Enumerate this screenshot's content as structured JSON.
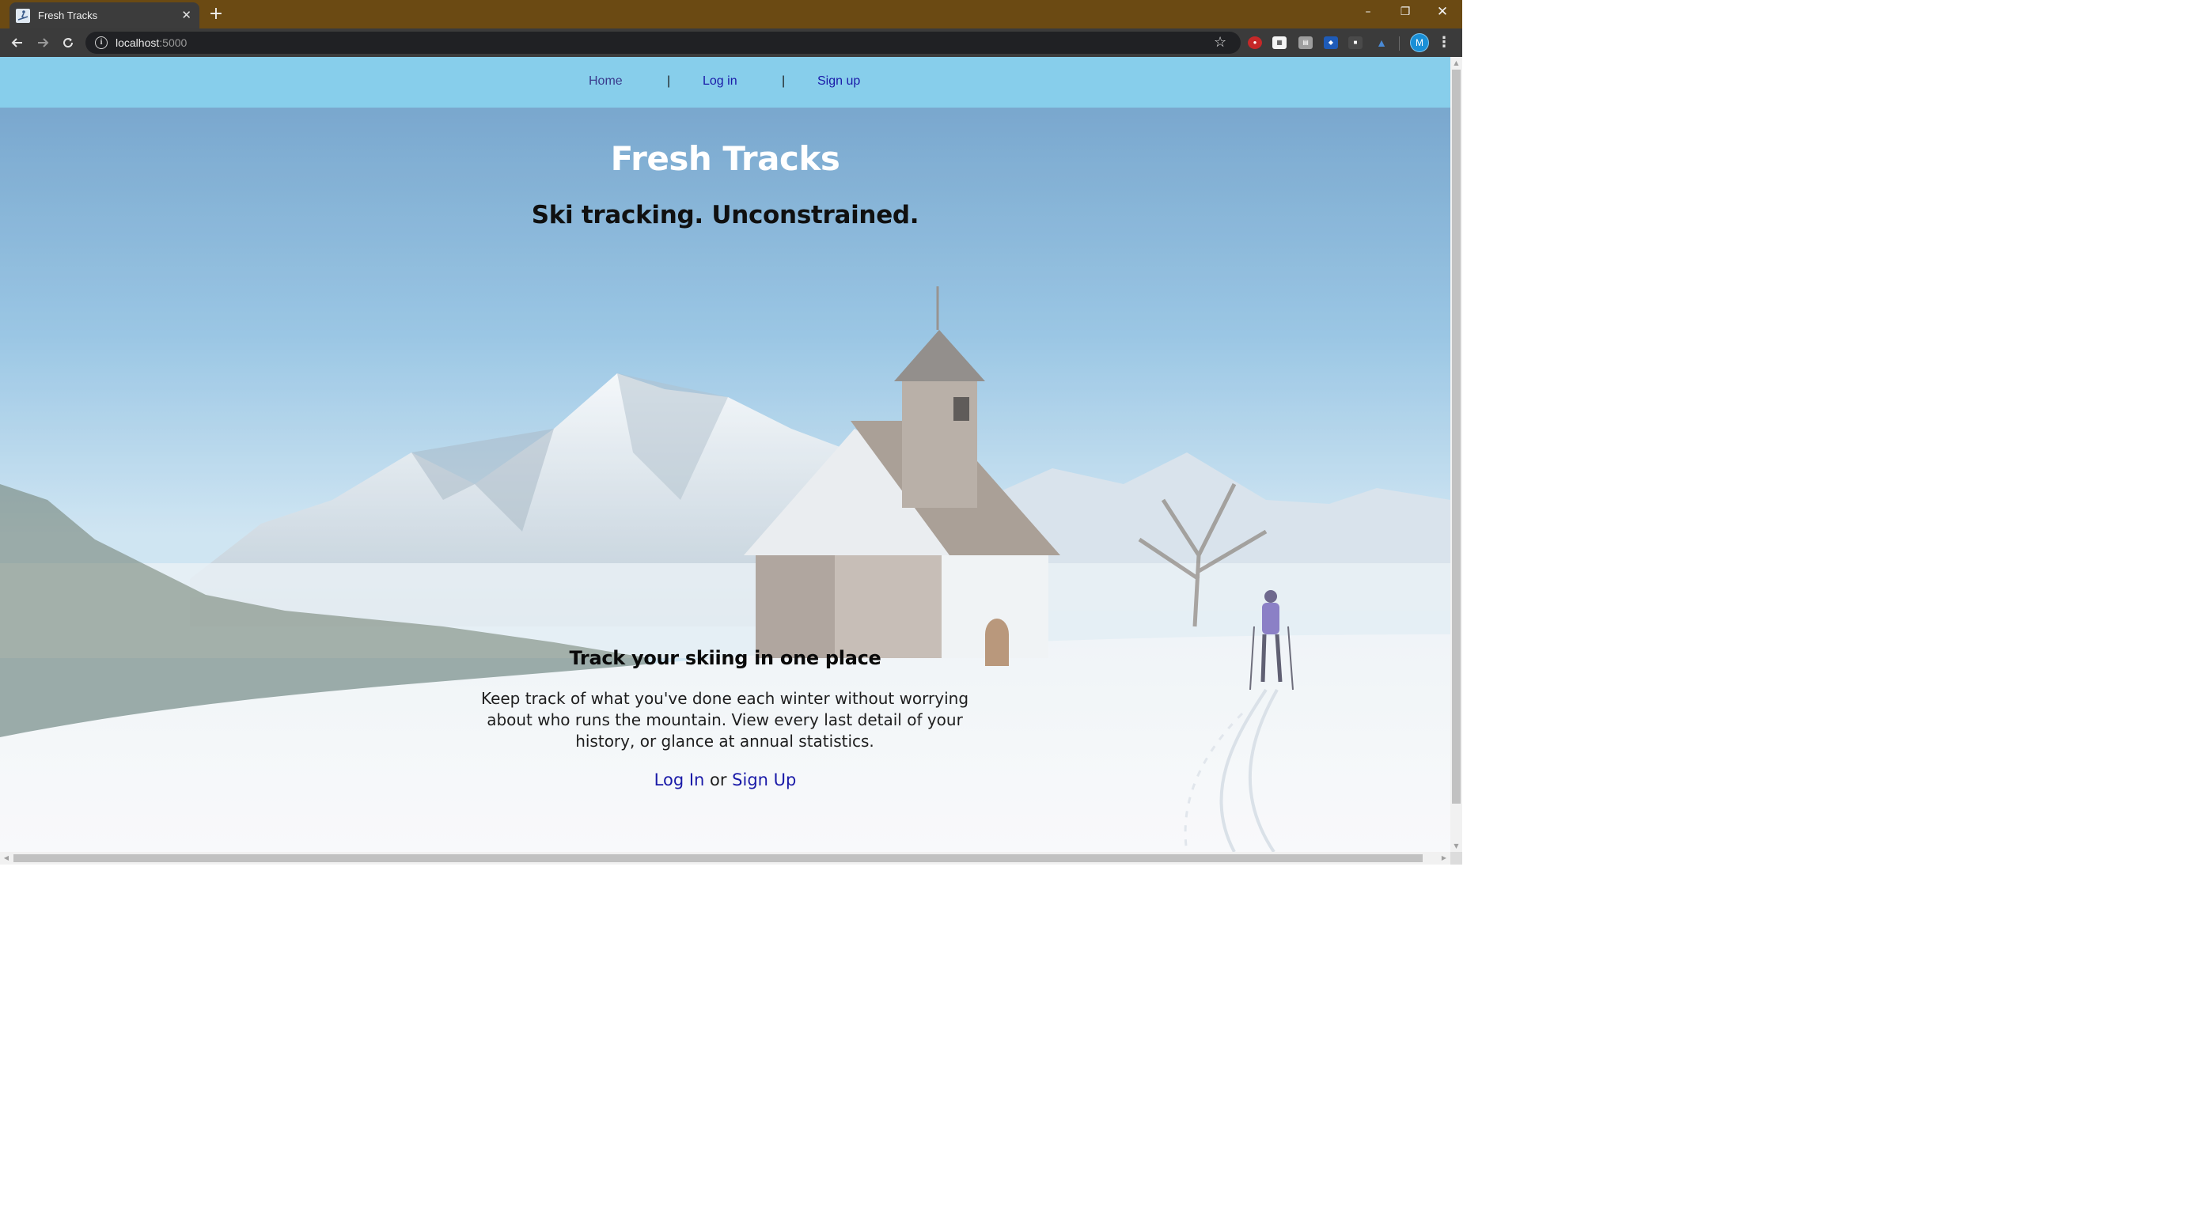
{
  "browser": {
    "tab_title": "Fresh Tracks",
    "tab_close": "✕",
    "new_tab": "+",
    "url_host": "localhost",
    "url_port": ":5000",
    "avatar_letter": "M",
    "window_controls": {
      "minimize": "–",
      "restore": "❐",
      "close": "✕"
    },
    "icons": [
      "back-arrow-icon",
      "forward-arrow-icon",
      "reload-icon",
      "info-icon",
      "star-icon",
      "menu-icon"
    ]
  },
  "navbar": {
    "home": "Home",
    "separator": "|",
    "login": "Log in",
    "signup": "Sign up"
  },
  "hero": {
    "title": "Fresh Tracks",
    "subtitle": "Ski tracking. Unconstrained."
  },
  "feature": {
    "title": "Track your skiing in one place",
    "text": "Keep track of what you've done each winter without worrying about who runs the mountain. View every last detail of your history, or glance at annual statistics.",
    "cta_login": "Log In",
    "cta_or": " or ",
    "cta_signup": "Sign Up"
  },
  "colors": {
    "titlebar": "#6b4a13",
    "navbar": "#87ceeb",
    "link": "#1a1aa8",
    "hero_title": "#ffffff"
  }
}
